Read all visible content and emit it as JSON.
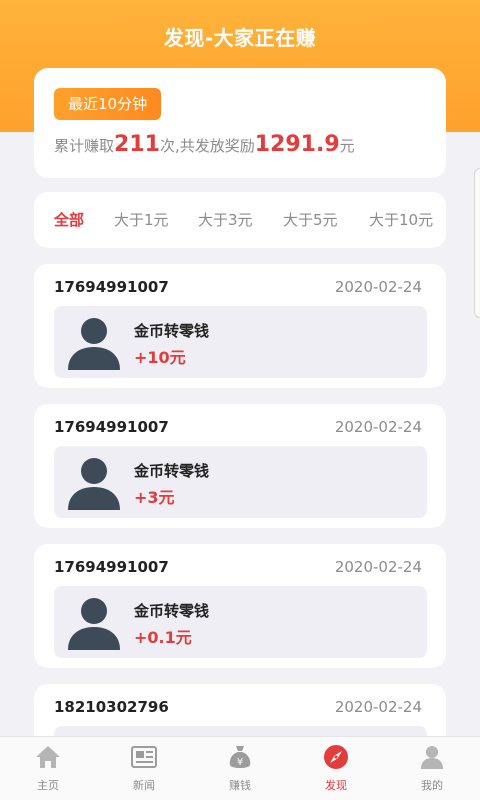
{
  "header": {
    "title": "发现-大家正在赚"
  },
  "summary": {
    "badge": "最近10分钟",
    "prefix": "累计赚取",
    "count": "211",
    "middle": "次,共发放奖励",
    "amount": "1291.9",
    "unit": "元"
  },
  "filters": [
    {
      "label": "全部",
      "active": true
    },
    {
      "label": "大于1元"
    },
    {
      "label": "大于3元"
    },
    {
      "label": "大于5元"
    },
    {
      "label": "大于10元"
    }
  ],
  "records": [
    {
      "phone": "17694991007",
      "date": "2020-02-24",
      "title": "金币转零钱",
      "amount": "+10元"
    },
    {
      "phone": "17694991007",
      "date": "2020-02-24",
      "title": "金币转零钱",
      "amount": "+3元"
    },
    {
      "phone": "17694991007",
      "date": "2020-02-24",
      "title": "金币转零钱",
      "amount": "+0.1元"
    },
    {
      "phone": "18210302796",
      "date": "2020-02-24",
      "title": "",
      "amount": ""
    }
  ],
  "nav": [
    {
      "label": "主页",
      "icon": "home-icon"
    },
    {
      "label": "新闻",
      "icon": "news-icon"
    },
    {
      "label": "赚钱",
      "icon": "money-bag-icon"
    },
    {
      "label": "发现",
      "icon": "compass-icon",
      "active": true
    },
    {
      "label": "我的",
      "icon": "user-icon"
    }
  ],
  "colors": {
    "header": "#ffa12c",
    "accent": "#e23c3c",
    "card_inner": "#efeef5",
    "avatar": "#3d4a57"
  }
}
